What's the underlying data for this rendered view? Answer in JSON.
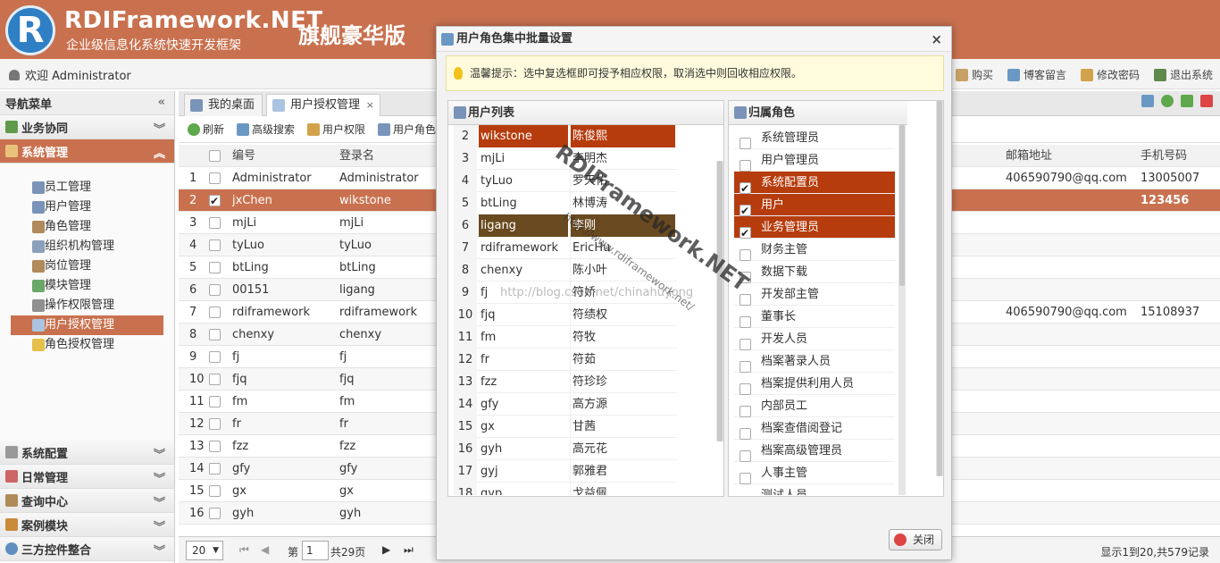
{
  "header": {
    "logo_letter": "R",
    "title": "RDIFramework.NET",
    "subtitle": "企业级信息化系统快速开发框架",
    "edition": "旗舰豪华版"
  },
  "topbar": {
    "welcome": "欢迎 Administrator",
    "links": [
      "购买",
      "博客留言",
      "修改密码",
      "退出系统"
    ]
  },
  "sidebar": {
    "title": "导航菜单",
    "sections_top": [
      "业务协同",
      "系统管理"
    ],
    "items": [
      "员工管理",
      "用户管理",
      "角色管理",
      "组织机构管理",
      "岗位管理",
      "模块管理",
      "操作权限管理",
      "用户授权管理",
      "角色授权管理"
    ],
    "sections_bottom": [
      "系统配置",
      "日常管理",
      "查询中心",
      "案例模块",
      "三方控件整合"
    ]
  },
  "tabs": [
    "我的桌面",
    "用户授权管理"
  ],
  "toolbar": [
    "刷新",
    "高级搜索",
    "用户权限",
    "用户角色"
  ],
  "grid": {
    "headers": {
      "no": "编号",
      "login": "登录名",
      "email": "邮箱地址",
      "phone": "手机号码"
    },
    "rows": [
      {
        "n": "1",
        "no": "Administrator",
        "login": "Administrator",
        "email": "406590790@qq.com",
        "phone": "13005007",
        "checked": false
      },
      {
        "n": "2",
        "no": "jxChen",
        "login": "wikstone",
        "email": "",
        "phone": "123456",
        "checked": true
      },
      {
        "n": "3",
        "no": "mjLi",
        "login": "mjLi",
        "email": "",
        "phone": "",
        "checked": false
      },
      {
        "n": "4",
        "no": "tyLuo",
        "login": "tyLuo",
        "email": "",
        "phone": "",
        "checked": false
      },
      {
        "n": "5",
        "no": "btLing",
        "login": "btLing",
        "email": "",
        "phone": "",
        "checked": false
      },
      {
        "n": "6",
        "no": "00151",
        "login": "ligang",
        "email": "",
        "phone": "",
        "checked": false
      },
      {
        "n": "7",
        "no": "rdiframework",
        "login": "rdiframework",
        "email": "406590790@qq.com",
        "phone": "15108937",
        "checked": false
      },
      {
        "n": "8",
        "no": "chenxy",
        "login": "chenxy",
        "email": "",
        "phone": "",
        "checked": false
      },
      {
        "n": "9",
        "no": "fj",
        "login": "fj",
        "email": "",
        "phone": "",
        "checked": false
      },
      {
        "n": "10",
        "no": "fjq",
        "login": "fjq",
        "email": "",
        "phone": "",
        "checked": false
      },
      {
        "n": "11",
        "no": "fm",
        "login": "fm",
        "email": "",
        "phone": "",
        "checked": false
      },
      {
        "n": "12",
        "no": "fr",
        "login": "fr",
        "email": "",
        "phone": "",
        "checked": false
      },
      {
        "n": "13",
        "no": "fzz",
        "login": "fzz",
        "email": "",
        "phone": "",
        "checked": false
      },
      {
        "n": "14",
        "no": "gfy",
        "login": "gfy",
        "email": "",
        "phone": "",
        "checked": false
      },
      {
        "n": "15",
        "no": "gx",
        "login": "gx",
        "email": "",
        "phone": "",
        "checked": false
      },
      {
        "n": "16",
        "no": "gyh",
        "login": "gyh",
        "email": "",
        "phone": "",
        "checked": false
      }
    ]
  },
  "pager": {
    "page_size": "20",
    "page_label": "第",
    "page": "1",
    "total_pages": "共29页",
    "summary": "显示1到20,共579记录"
  },
  "dialog": {
    "title": "用户角色集中批量设置",
    "tip": "温馨提示：选中复选框即可授予相应权限，取消选中则回收相应权限。",
    "users_title": "用户列表",
    "roles_title": "归属角色",
    "close_label": "关闭",
    "users": [
      {
        "n": "2",
        "a": "wikstone",
        "b": "陈俊熙",
        "state": "sel"
      },
      {
        "n": "3",
        "a": "mjLi",
        "b": "李明杰",
        "state": ""
      },
      {
        "n": "4",
        "a": "tyLuo",
        "b": "罗天佑",
        "state": ""
      },
      {
        "n": "5",
        "a": "btLing",
        "b": "林博涛",
        "state": ""
      },
      {
        "n": "6",
        "a": "ligang",
        "b": "李刚",
        "state": "sel2"
      },
      {
        "n": "7",
        "a": "rdiframework",
        "b": "EricHu",
        "state": ""
      },
      {
        "n": "8",
        "a": "chenxy",
        "b": "陈小叶",
        "state": ""
      },
      {
        "n": "9",
        "a": "fj",
        "b": "符娇",
        "state": ""
      },
      {
        "n": "10",
        "a": "fjq",
        "b": "符绩权",
        "state": ""
      },
      {
        "n": "11",
        "a": "fm",
        "b": "符牧",
        "state": ""
      },
      {
        "n": "12",
        "a": "fr",
        "b": "符茹",
        "state": ""
      },
      {
        "n": "13",
        "a": "fzz",
        "b": "符珍珍",
        "state": ""
      },
      {
        "n": "14",
        "a": "gfy",
        "b": "高方源",
        "state": ""
      },
      {
        "n": "15",
        "a": "gx",
        "b": "甘茜",
        "state": ""
      },
      {
        "n": "16",
        "a": "gyh",
        "b": "高元花",
        "state": ""
      },
      {
        "n": "17",
        "a": "gyj",
        "b": "郭雅君",
        "state": ""
      },
      {
        "n": "18",
        "a": "gyp",
        "b": "戈益佩",
        "state": ""
      }
    ],
    "roles": [
      {
        "name": "系统管理员",
        "checked": false
      },
      {
        "name": "用户管理员",
        "checked": false
      },
      {
        "name": "系统配置员",
        "checked": true
      },
      {
        "name": "用户",
        "checked": true
      },
      {
        "name": "业务管理员",
        "checked": true
      },
      {
        "name": "财务主管",
        "checked": false
      },
      {
        "name": "数据下载",
        "checked": false
      },
      {
        "name": "开发部主管",
        "checked": false
      },
      {
        "name": "董事长",
        "checked": false
      },
      {
        "name": "开发人员",
        "checked": false
      },
      {
        "name": "档案著录人员",
        "checked": false
      },
      {
        "name": "档案提供利用人员",
        "checked": false
      },
      {
        "name": "内部员工",
        "checked": false
      },
      {
        "name": "档案查借阅登记",
        "checked": false
      },
      {
        "name": "档案高级管理员",
        "checked": false
      },
      {
        "name": "人事主管",
        "checked": false
      },
      {
        "name": "测试人员",
        "checked": false
      }
    ]
  },
  "watermark": {
    "brand": "RDIFramework.NET",
    "url": "http://www.rdiframework.net/",
    "blog": "http://blog.csdn.net/chinahuyong"
  },
  "colors": {
    "accent": "#c9714f",
    "selection": "#b63c0d"
  }
}
